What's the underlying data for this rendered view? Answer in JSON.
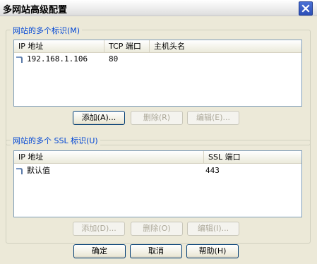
{
  "window": {
    "title": "多网站高级配置",
    "close_icon": "close-icon"
  },
  "identities": {
    "group_label": "网站的多个标识(M)",
    "columns": [
      "IP 地址",
      "TCP 端口",
      "主机头名"
    ],
    "rows": [
      {
        "ip": "192.168.1.106",
        "port": "80",
        "host": "",
        "icon": "network-pipe-icon"
      }
    ],
    "buttons": {
      "add": "添加(A)...",
      "remove": "删除(R)",
      "edit": "编辑(E)..."
    }
  },
  "ssl": {
    "group_label": "网站的多个 SSL 标识(U)",
    "columns": [
      "IP 地址",
      "SSL 端口"
    ],
    "rows": [
      {
        "ip": "默认值",
        "port": "443",
        "icon": "network-pipe-icon"
      }
    ],
    "buttons": {
      "add": "添加(D)...",
      "remove": "删除(O)",
      "edit": "编辑(I)..."
    }
  },
  "footer": {
    "ok": "确定",
    "cancel": "取消",
    "help": "帮助(H)"
  },
  "colors": {
    "dialog_bg": "#ece9d8",
    "group_label": "#0046d5",
    "list_border": "#7f9db9",
    "close_button": "#2d4fb8"
  }
}
